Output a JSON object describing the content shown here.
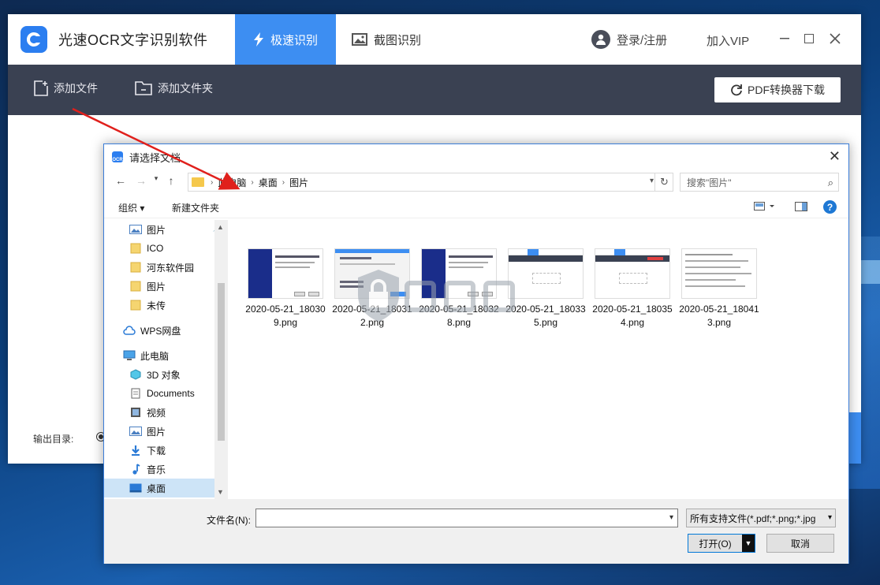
{
  "app": {
    "title": "光速OCR文字识别软件",
    "tabs": [
      {
        "label": "极速识别",
        "icon": "lightning-icon",
        "active": true
      },
      {
        "label": "截图识别",
        "icon": "image-icon",
        "active": false
      }
    ],
    "login_label": "登录/注册",
    "vip_label": "加入VIP",
    "accent_color": "#3d8ef2",
    "toolbar": {
      "add_file": "添加文件",
      "add_folder": "添加文件夹",
      "pdf_download": "PDF转换器下载"
    },
    "output_label": "输出目录:"
  },
  "dialog": {
    "title": "请选择文档",
    "breadcrumb": [
      "此电脑",
      "桌面",
      "图片"
    ],
    "search_placeholder": "搜索\"图片\"",
    "commands": {
      "organize": "组织 ▾",
      "new_folder": "新建文件夹"
    },
    "nav_items": [
      {
        "label": "图片",
        "icon": "picture-folder-icon",
        "pinned": true
      },
      {
        "label": "ICO",
        "icon": "folder-icon"
      },
      {
        "label": "河东软件园",
        "icon": "folder-icon"
      },
      {
        "label": "图片",
        "icon": "folder-icon"
      },
      {
        "label": "未传",
        "icon": "folder-icon"
      },
      {
        "label": "WPS网盘",
        "icon": "cloud-icon"
      },
      {
        "label": "此电脑",
        "icon": "computer-icon"
      },
      {
        "label": "3D 对象",
        "icon": "cube-icon"
      },
      {
        "label": "Documents",
        "icon": "document-icon"
      },
      {
        "label": "视频",
        "icon": "video-icon"
      },
      {
        "label": "图片",
        "icon": "picture-folder-icon"
      },
      {
        "label": "下载",
        "icon": "download-icon"
      },
      {
        "label": "音乐",
        "icon": "music-icon"
      },
      {
        "label": "桌面",
        "icon": "desktop-icon",
        "selected": true
      }
    ],
    "files": [
      {
        "name": "2020-05-21_180309.png",
        "thumb": "installer-dark"
      },
      {
        "name": "2020-05-21_180312.png",
        "thumb": "dialog-light"
      },
      {
        "name": "2020-05-21_180328.png",
        "thumb": "installer-dark"
      },
      {
        "name": "2020-05-21_180335.png",
        "thumb": "app-window"
      },
      {
        "name": "2020-05-21_180354.png",
        "thumb": "app-window-red"
      },
      {
        "name": "2020-05-21_180413.png",
        "thumb": "text-doc"
      }
    ],
    "filename_label": "文件名(N):",
    "filename_value": "",
    "filetype_value": "所有支持文件(*.pdf;*.png;*.jpg",
    "open_label": "打开(O)",
    "cancel_label": "取消"
  }
}
